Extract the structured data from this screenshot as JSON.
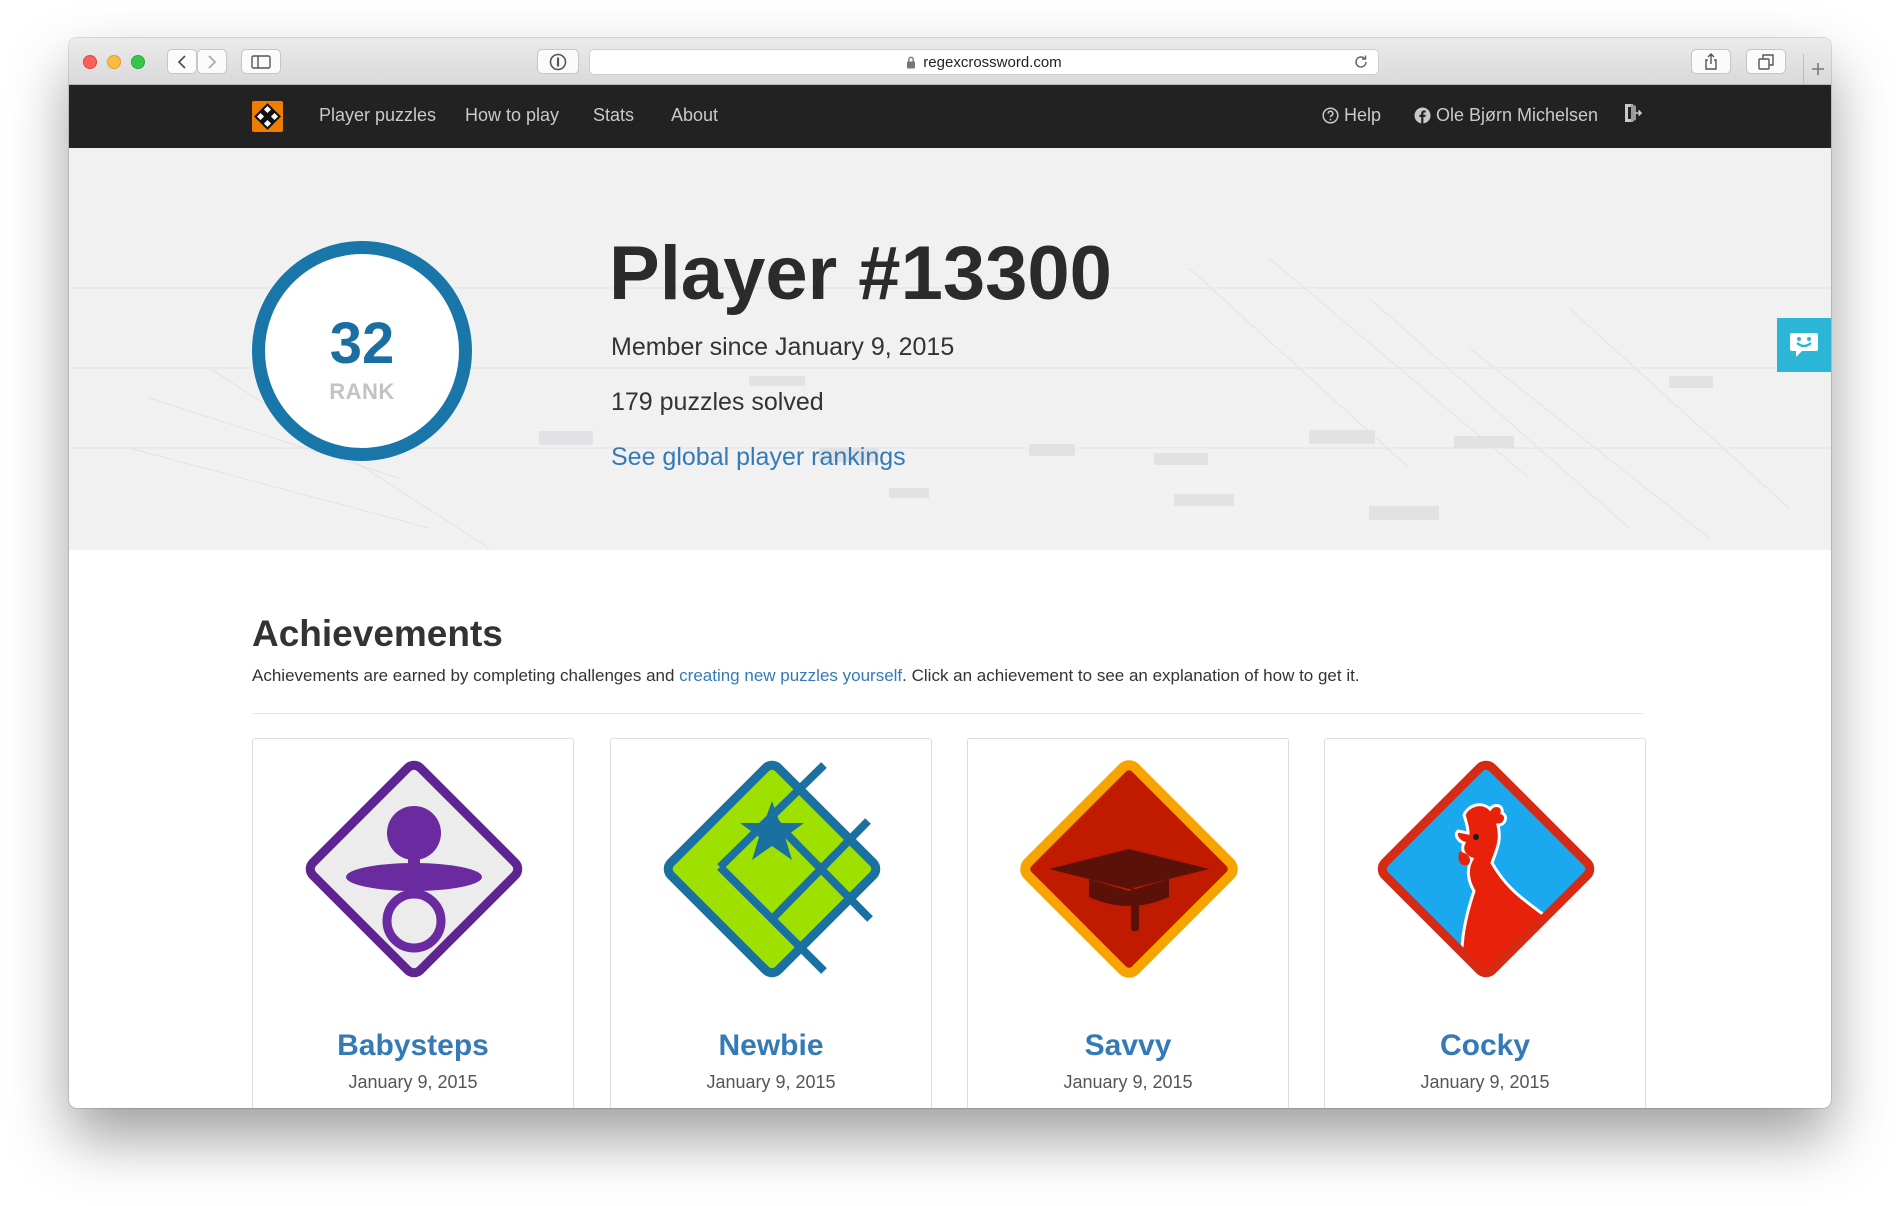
{
  "browser": {
    "url": "regexcrossword.com"
  },
  "nav": {
    "items": [
      {
        "label": "Player puzzles"
      },
      {
        "label": "How to play"
      },
      {
        "label": "Stats"
      },
      {
        "label": "About"
      }
    ],
    "help": "Help",
    "user": "Ole Bjørn Michelsen"
  },
  "hero": {
    "rank_value": "32",
    "rank_label": "RANK",
    "title": "Player #13300",
    "member_since": "Member since January 9, 2015",
    "puzzles_solved": "179 puzzles solved",
    "rankings_link": "See global player rankings"
  },
  "achievements": {
    "title": "Achievements",
    "desc_before": "Achievements are earned by completing challenges and ",
    "desc_link": "creating new puzzles yourself",
    "desc_after": ". Click an achievement to see an explanation of how to get it.",
    "cards": [
      {
        "name": "Babysteps",
        "date": "January 9, 2015",
        "icon": "pacifier-icon"
      },
      {
        "name": "Newbie",
        "date": "January 9, 2015",
        "icon": "star-icon"
      },
      {
        "name": "Savvy",
        "date": "January 9, 2015",
        "icon": "graduation-cap-icon"
      },
      {
        "name": "Cocky",
        "date": "January 9, 2015",
        "icon": "rooster-icon"
      }
    ]
  },
  "colors": {
    "navbar": "#222222",
    "link": "#337ab7",
    "rank_ring": "#1877a8",
    "feedback": "#2bb5d6"
  }
}
